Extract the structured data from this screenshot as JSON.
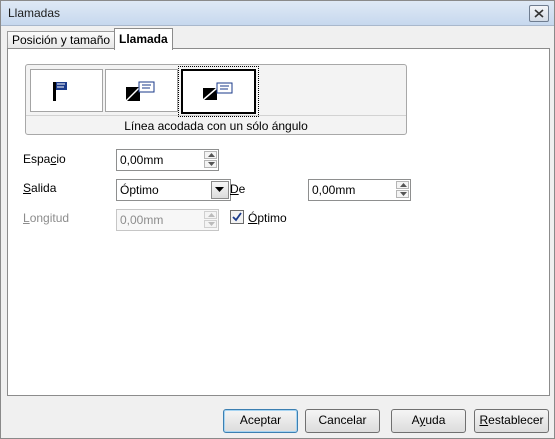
{
  "window": {
    "title": "Llamadas"
  },
  "tabs": [
    {
      "label": "Posición y tamaño",
      "active": false
    },
    {
      "label": "Llamada",
      "active": true
    }
  ],
  "callout_types": {
    "options": [
      {
        "name": "callout-type-straight-icon"
      },
      {
        "name": "callout-type-angled-icon"
      },
      {
        "name": "callout-type-one-angle-icon",
        "selected": true
      }
    ],
    "description": "Línea acodada con un sólo ángulo"
  },
  "fields": {
    "espacio": {
      "label_pre": "Espa",
      "label_u": "c",
      "label_post": "io",
      "value": "0,00mm"
    },
    "salida": {
      "label_pre": "",
      "label_u": "S",
      "label_post": "alida",
      "value": "Óptimo"
    },
    "de": {
      "label_pre": "",
      "label_u": "D",
      "label_post": "e",
      "value": "0,00mm"
    },
    "longitud": {
      "label_pre": "",
      "label_u": "L",
      "label_post": "ongitud",
      "value": "0,00mm",
      "disabled": true
    },
    "optimo": {
      "label_pre": "",
      "label_u": "Ó",
      "label_post": "ptimo",
      "checked": true
    }
  },
  "buttons": {
    "accept": "Aceptar",
    "cancel": "Cancelar",
    "help_pre": "A",
    "help_u": "y",
    "help_post": "uda",
    "reset_pre": "",
    "reset_u": "R",
    "reset_post": "establecer"
  },
  "colors": {
    "accent": "#3c7fb1",
    "disabled_text": "#8c8c8c"
  }
}
